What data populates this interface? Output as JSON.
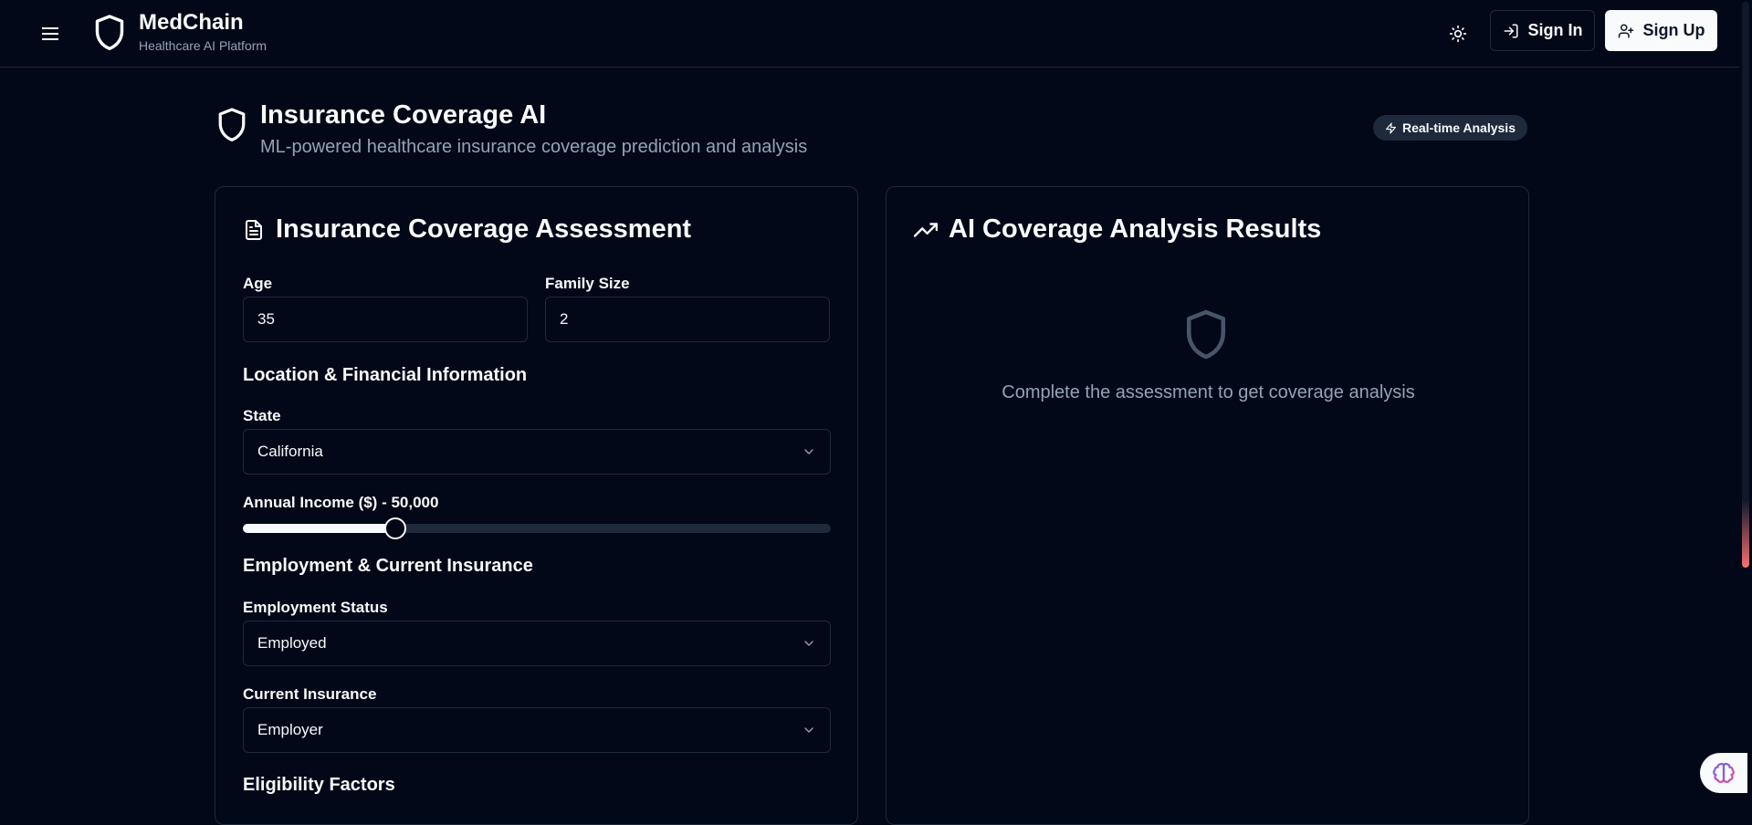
{
  "header": {
    "brand_name": "MedChain",
    "brand_tagline": "Healthcare AI Platform",
    "sign_in_label": "Sign In",
    "sign_up_label": "Sign Up"
  },
  "page": {
    "title": "Insurance Coverage AI",
    "subtitle": "ML-powered healthcare insurance coverage prediction and analysis",
    "badge": "Real-time Analysis"
  },
  "assessment": {
    "title": "Insurance Coverage Assessment",
    "age_label": "Age",
    "age_value": "35",
    "family_label": "Family Size",
    "family_value": "2",
    "location_section": "Location & Financial Information",
    "state_label": "State",
    "state_value": "California",
    "income_label": "Annual Income ($) - 50,000",
    "income_fraction": 0.26,
    "employment_section": "Employment & Current Insurance",
    "employment_label": "Employment Status",
    "employment_value": "Employed",
    "insurance_label": "Current Insurance",
    "insurance_value": "Employer",
    "eligibility_section": "Eligibility Factors"
  },
  "results": {
    "title": "AI Coverage Analysis Results",
    "empty_message": "Complete the assessment to get coverage analysis"
  },
  "icons": {
    "menu": "menu-icon",
    "logo": "shield-icon",
    "theme": "sun-icon",
    "sign_in": "log-in-icon",
    "sign_up": "user-plus-icon",
    "badge": "zap-icon",
    "assessment": "file-text-icon",
    "results": "trending-up-icon",
    "chevron": "chevron-down-icon",
    "assistant": "brain-icon"
  }
}
